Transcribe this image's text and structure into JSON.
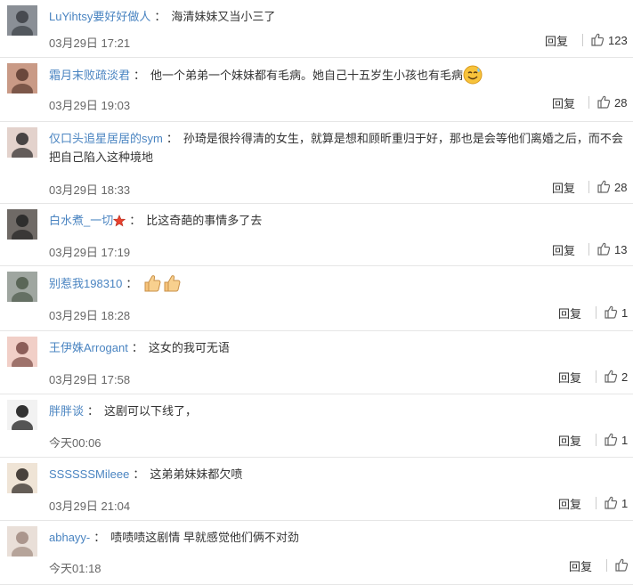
{
  "labels": {
    "reply": "回复",
    "separator": "："
  },
  "comments": [
    {
      "user": "LuYihtsy要好好做人",
      "text": "海清妹妹又当小三了",
      "date": "03月29日 17:21",
      "likes": "123"
    },
    {
      "user": "霜月末败疏淡君",
      "text": "他一个弟弟一个妹妹都有毛病。她自己十五岁生小孩也有毛病",
      "date": "03月29日 19:03",
      "likes": "28",
      "emoji": "sweat-smile-emoji"
    },
    {
      "user": "仅口头追星居居的sym",
      "text": "孙琦是很拎得清的女生，就算是想和顾昕重归于好，那也是会等他们离婚之后，而不会把自己陷入这种境地",
      "date": "03月29日 18:33",
      "likes": "28"
    },
    {
      "user": "白水煮_一切",
      "text": "比这奇葩的事情多了去",
      "date": "03月29日 17:19",
      "likes": "13",
      "badge": "red-star-badge-icon"
    },
    {
      "user": "别惹我198310",
      "text": "",
      "date": "03月29日 18:28",
      "likes": "1",
      "emoji": "thumbs-up-emoji"
    },
    {
      "user": "王伊姝Arrogant",
      "text": "这女的我可无语",
      "date": "03月29日 17:58",
      "likes": "2"
    },
    {
      "user": "胖胖谈",
      "text": "这剧可以下线了，",
      "date": "今天00:06",
      "likes": "1"
    },
    {
      "user": "SSSSSSMileee",
      "text": "这弟弟妹妹都欠喷",
      "date": "03月29日 21:04",
      "likes": "1"
    },
    {
      "user": "abhayy-",
      "text": "啧啧啧这剧情 早就感觉他们俩不对劲",
      "date": "今天01:18",
      "likes": ""
    }
  ],
  "colors": {
    "username": "#4a84c1",
    "divider": "#e6e6e6",
    "text": "#333333",
    "date": "#666666"
  }
}
